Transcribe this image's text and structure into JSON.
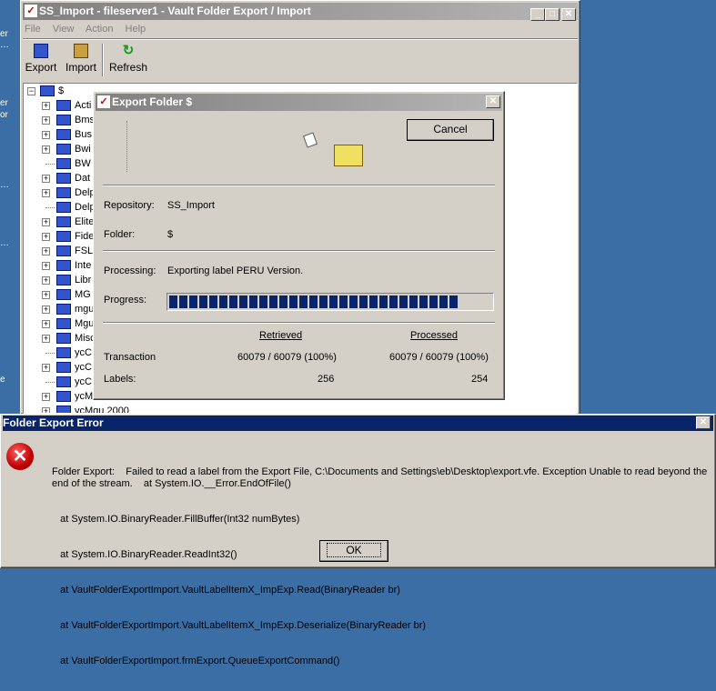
{
  "desktop": {
    "fragments": [
      "er",
      "…",
      "er",
      "or",
      "…",
      "…",
      "e"
    ]
  },
  "main": {
    "title": "SS_Import - fileserver1 - Vault Folder Export / Import",
    "menu": [
      "File",
      "View",
      "Action",
      "Help"
    ],
    "toolbar": [
      {
        "label": "Export",
        "icon": "export-icon"
      },
      {
        "label": "Import",
        "icon": "import-icon"
      },
      {
        "label": "Refresh",
        "icon": "refresh-icon"
      }
    ],
    "tree": {
      "root": "$",
      "items": [
        {
          "label": "Acti",
          "expandable": true
        },
        {
          "label": "Bms",
          "expandable": true
        },
        {
          "label": "Bus",
          "expandable": true
        },
        {
          "label": "Bwi",
          "expandable": true
        },
        {
          "label": "BW",
          "expandable": false
        },
        {
          "label": "Dat",
          "expandable": true
        },
        {
          "label": "Delp",
          "expandable": true
        },
        {
          "label": "Delp",
          "expandable": false
        },
        {
          "label": "Elite",
          "expandable": true
        },
        {
          "label": "Fide",
          "expandable": true
        },
        {
          "label": "FSL",
          "expandable": true
        },
        {
          "label": "Inte",
          "expandable": true
        },
        {
          "label": "Libr",
          "expandable": true
        },
        {
          "label": "MG",
          "expandable": true
        },
        {
          "label": "mgu",
          "expandable": true
        },
        {
          "label": "Mgu",
          "expandable": true
        },
        {
          "label": "Misc",
          "expandable": true
        },
        {
          "label": "ycC",
          "expandable": false
        },
        {
          "label": "ycC",
          "expandable": true
        },
        {
          "label": "ycC",
          "expandable": false
        },
        {
          "label": "ycM",
          "expandable": true
        },
        {
          "label": "ycMgu 2000",
          "expandable": true
        }
      ]
    }
  },
  "export_dialog": {
    "title": "Export Folder $",
    "cancel": "Cancel",
    "repository_label": "Repository:",
    "repository": "SS_Import",
    "folder_label": "Folder:",
    "folder": "$",
    "processing_label": "Processing:",
    "processing": "Exporting label PERU Version.",
    "progress_label": "Progress:",
    "progress_percent": 90,
    "col_retrieved": "Retrieved",
    "col_processed": "Processed",
    "transaction_label": "Transaction",
    "transaction_retrieved": "60079 / 60079 (100%)",
    "transaction_processed": "60079 / 60079 (100%)",
    "labels_label": "Labels:",
    "labels_retrieved": "256",
    "labels_processed": "254"
  },
  "error_dialog": {
    "title": "Folder Export Error",
    "message": [
      "Folder Export:    Failed to read a label from the Export File, C:\\Documents and Settings\\eb\\Desktop\\export.vfe. Exception Unable to read beyond the end of the stream.    at System.IO.__Error.EndOfFile()",
      "   at System.IO.BinaryReader.FillBuffer(Int32 numBytes)",
      "   at System.IO.BinaryReader.ReadInt32()",
      "   at VaultFolderExportImport.VaultLabelItemX_ImpExp.Read(BinaryReader br)",
      "   at VaultFolderExportImport.VaultLabelItemX_ImpExp.Deserialize(BinaryReader br)",
      "   at VaultFolderExportImport.frmExport.QueueExportCommand()"
    ],
    "ok": "OK",
    "accent": "#0a246a"
  }
}
